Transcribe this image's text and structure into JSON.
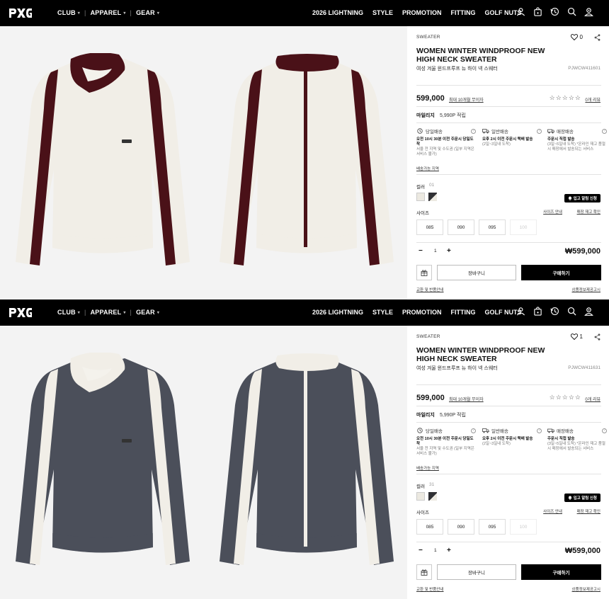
{
  "header": {
    "nav_left": [
      "CLUB",
      "APPAREL",
      "GEAR"
    ],
    "nav_right": [
      "2026 LIGHTNING",
      "STYLE",
      "PROMOTION",
      "FITTING",
      "GOLF NUTS"
    ],
    "icons": [
      "user-icon",
      "bag-icon",
      "history-icon",
      "search-icon",
      "member-icon"
    ]
  },
  "products": [
    {
      "category": "SWEATER",
      "likes": "0",
      "title": "WOMEN WINTER WINDPROOF NEW HIGH NECK SWEATER",
      "subtitle": "여성 겨울 윈드프루프 뉴 하이 넥 스웨터",
      "code": "PJWCW411601",
      "price": "599,000",
      "installment": "최대 10개월 무이자",
      "stars": "☆☆☆☆☆",
      "reviews": "0개 리뷰",
      "mileage_label": "마일리지",
      "mileage_value": "5,990P 적립",
      "shipping": [
        {
          "title": "당일배송",
          "line1": "오전 10시 30분 이전 주문시 당일도착",
          "line2": "서울 전 지역 및 수도권 (일부 지역은 서비스 불가)"
        },
        {
          "title": "일반배송",
          "line1": "오후 2시 이전 주문시 택배 발송",
          "line2": "(2일~3일내 도착)"
        },
        {
          "title": "매장배송",
          "line1": "주문시 직접 발송",
          "line2": "(3일~5일내 도착) *온라인 재고 품절시 매장에서 발송되는 서비스"
        }
      ],
      "shipping_link": "배송가능 지역",
      "color_label": "컬러",
      "color_code": "01",
      "swatches": [
        "#ece9e1",
        "#2f2f33"
      ],
      "restock_label": "입고 알림 신청",
      "size_label": "사이즈",
      "size_guide": "사이즈 안내",
      "size_stock": "매장 재고 확인",
      "sizes": [
        {
          "label": "085",
          "available": true
        },
        {
          "label": "090",
          "available": true
        },
        {
          "label": "095",
          "available": true
        },
        {
          "label": "100",
          "available": false
        }
      ],
      "qty": "1",
      "total": "₩599,000",
      "cart_label": "장바구니",
      "buy_label": "구매하기",
      "exchange_link": "교환 및 반품안내",
      "info_link": "상품정보제공고시",
      "colors": {
        "body": "#f1eee7",
        "accent": "#4a1118",
        "collar": "#4a1118",
        "inner_collar": "#f4f2ec"
      }
    },
    {
      "category": "SWEATER",
      "likes": "1",
      "title": "WOMEN WINTER WINDPROOF NEW HIGH NECK SWEATER",
      "subtitle": "여성 겨울 윈드프루프 뉴 하이 넥 스웨터",
      "code": "PJWCW411631",
      "price": "599,000",
      "installment": "최대 10개월 무이자",
      "stars": "☆☆☆☆☆",
      "reviews": "0개 리뷰",
      "mileage_label": "마일리지",
      "mileage_value": "5,990P 적립",
      "shipping": [
        {
          "title": "당일배송",
          "line1": "오전 10시 30분 이전 주문시 당일도착",
          "line2": "서울 전 지역 및 수도권 (일부 지역은 서비스 불가)"
        },
        {
          "title": "일반배송",
          "line1": "오후 2시 이전 주문시 택배 발송",
          "line2": "(2일~3일내 도착)"
        },
        {
          "title": "매장배송",
          "line1": "주문시 직접 발송",
          "line2": "(3일~5일내 도착) *온라인 재고 품절시 매장에서 발송되는 서비스"
        }
      ],
      "shipping_link": "배송가능 지역",
      "color_label": "컬러",
      "color_code": "31",
      "swatches": [
        "#ece9e1",
        "#2f2f33"
      ],
      "restock_label": "입고 알림 신청",
      "size_label": "사이즈",
      "size_guide": "사이즈 안내",
      "size_stock": "매장 재고 확인",
      "sizes": [
        {
          "label": "085",
          "available": true
        },
        {
          "label": "090",
          "available": true
        },
        {
          "label": "095",
          "available": true
        },
        {
          "label": "100",
          "available": false
        }
      ],
      "qty": "1",
      "total": "₩599,000",
      "cart_label": "장바구니",
      "buy_label": "구매하기",
      "exchange_link": "교환 및 반품안내",
      "info_link": "상품정보제공고시",
      "colors": {
        "body": "#4b4f5a",
        "accent": "#f1eee7",
        "collar": "#f1eee7",
        "inner_collar": "#f4f2ec"
      }
    }
  ]
}
